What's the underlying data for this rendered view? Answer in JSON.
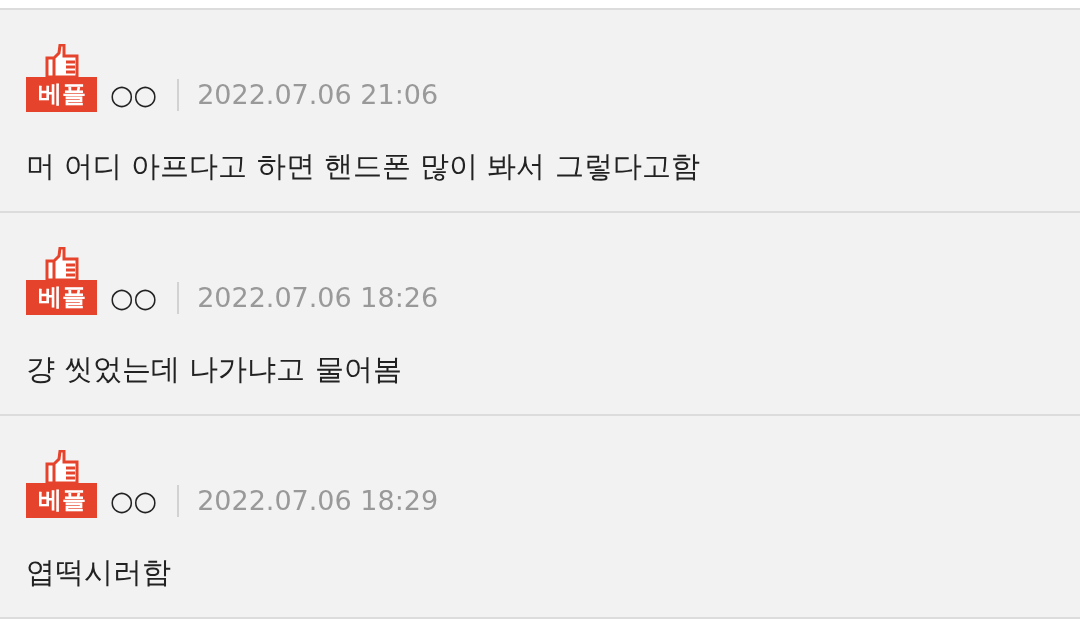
{
  "comments": [
    {
      "badge": "베플",
      "author": "○○",
      "date": "2022.07.06 21:06",
      "body": "머 어디 아프다고 하면 핸드폰 많이 봐서 그렇다고함"
    },
    {
      "badge": "베플",
      "author": "○○",
      "date": "2022.07.06 18:26",
      "body": "걍 씻었는데 나가냐고 물어봄"
    },
    {
      "badge": "베플",
      "author": "○○",
      "date": "2022.07.06 18:29",
      "body": "엽떡시러함"
    }
  ]
}
